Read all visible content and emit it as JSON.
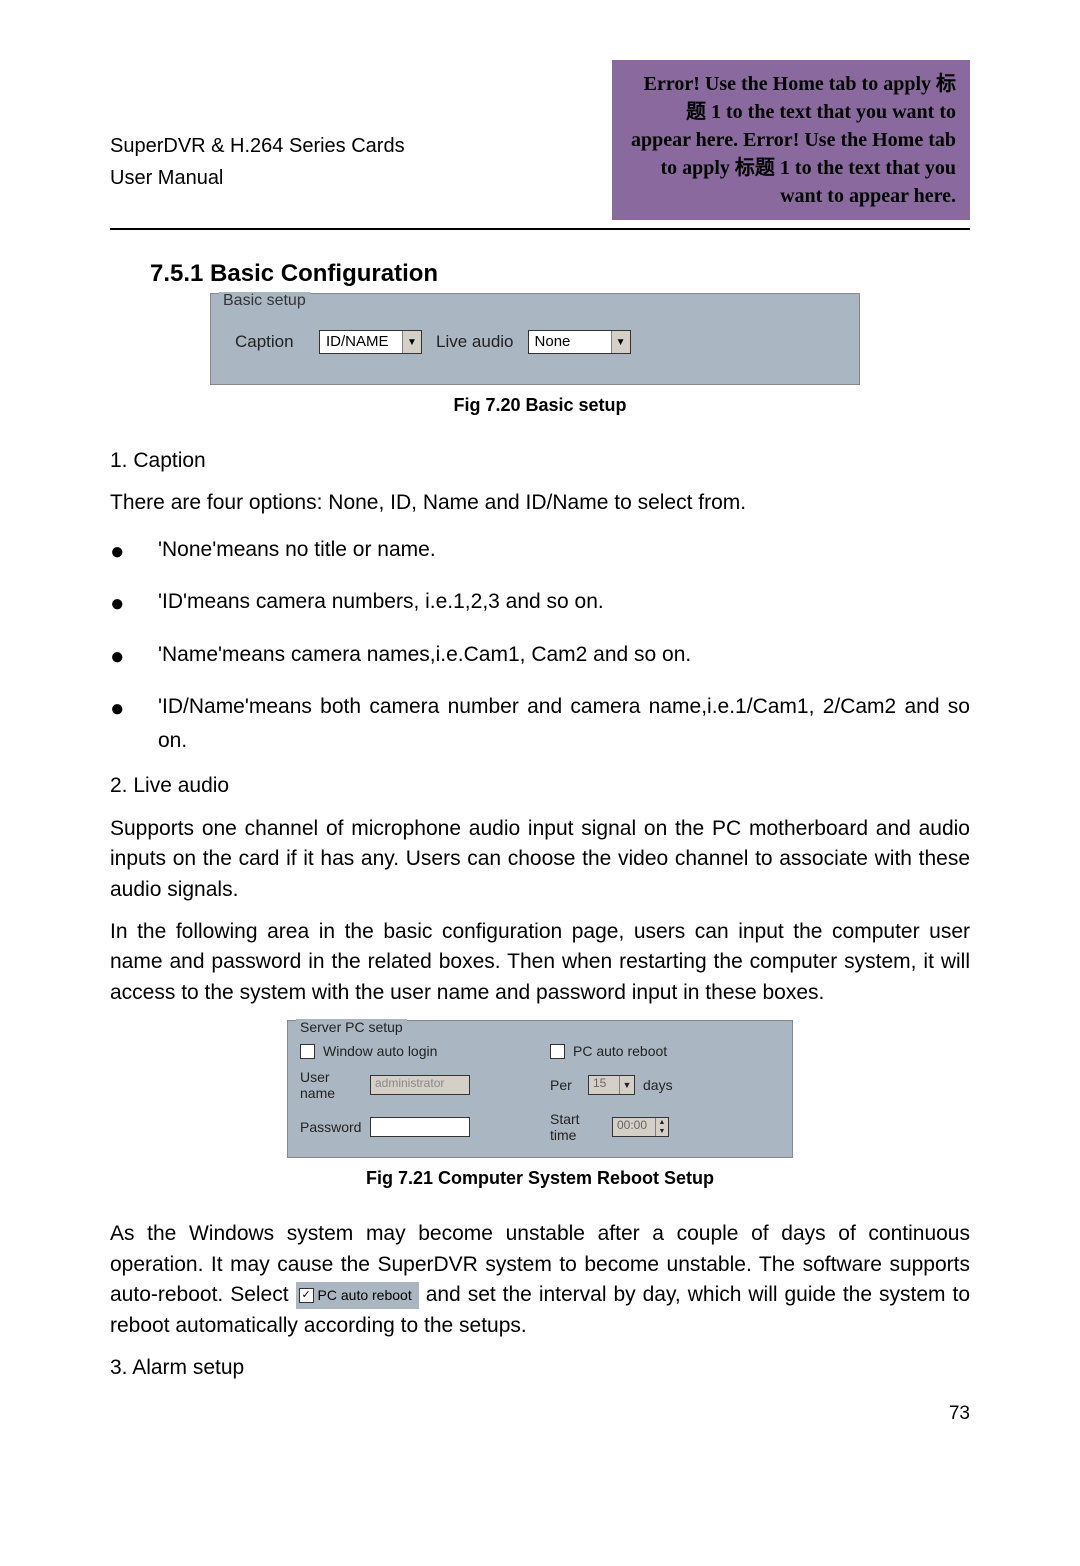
{
  "header": {
    "left_line1": "SuperDVR & H.264 Series Cards",
    "left_line2": "User Manual",
    "right": "Error! Use the Home tab to apply 标题 1 to the text that you want to appear here. Error! Use the Home tab to apply 标题 1 to the text that you want to appear here."
  },
  "section_title": "7.5.1  Basic Configuration",
  "fig720": {
    "group": "Basic setup",
    "caption_label": "Caption",
    "caption_value": "ID/NAME",
    "liveaudio_label": "Live audio",
    "liveaudio_value": "None",
    "figcaption": "Fig 7.20 Basic setup"
  },
  "p_caption": "1. Caption",
  "p_caption_desc": "There are four options: None, ID, Name and ID/Name to select from.",
  "bullets": [
    "'None'means no title or name.",
    "'ID'means camera numbers, i.e.1,2,3 and so on.",
    "'Name'means camera names,i.e.Cam1, Cam2 and so on.",
    "'ID/Name'means both camera number and camera name,i.e.1/Cam1, 2/Cam2 and so on."
  ],
  "p_liveaudio": "2. Live audio",
  "p_liveaudio_desc": "Supports one channel of microphone audio input signal on the PC motherboard and audio inputs on the card if it has any. Users can choose the video channel to associate with these audio signals.",
  "p_server_desc": "In the following area in the basic configuration page, users can input the computer user name and password in the related boxes. Then when restarting the computer system, it will access to the system with the user name and password input in these boxes.",
  "fig721": {
    "group": "Server PC setup",
    "win_auto_login": "Window auto login",
    "pc_auto_reboot": "PC auto reboot",
    "username_label": "User name",
    "username_value": "administrator",
    "password_label": "Password",
    "password_value": "",
    "per_label": "Per",
    "per_value": "15",
    "days_label": "days",
    "starttime_label": "Start time",
    "starttime_value": "00:00",
    "figcaption": "Fig 7.21 Computer System Reboot Setup"
  },
  "p_reboot_before": "As the Windows system may become unstable after a couple of days of continuous operation. It may cause the SuperDVR system to become unstable. The software supports auto-reboot. Select ",
  "inline_chk_label": "PC auto reboot",
  "p_reboot_after": " and set the interval by day, which will guide the system to reboot automatically according to the setups.",
  "p_alarm": "3. Alarm setup",
  "page_number": "73"
}
